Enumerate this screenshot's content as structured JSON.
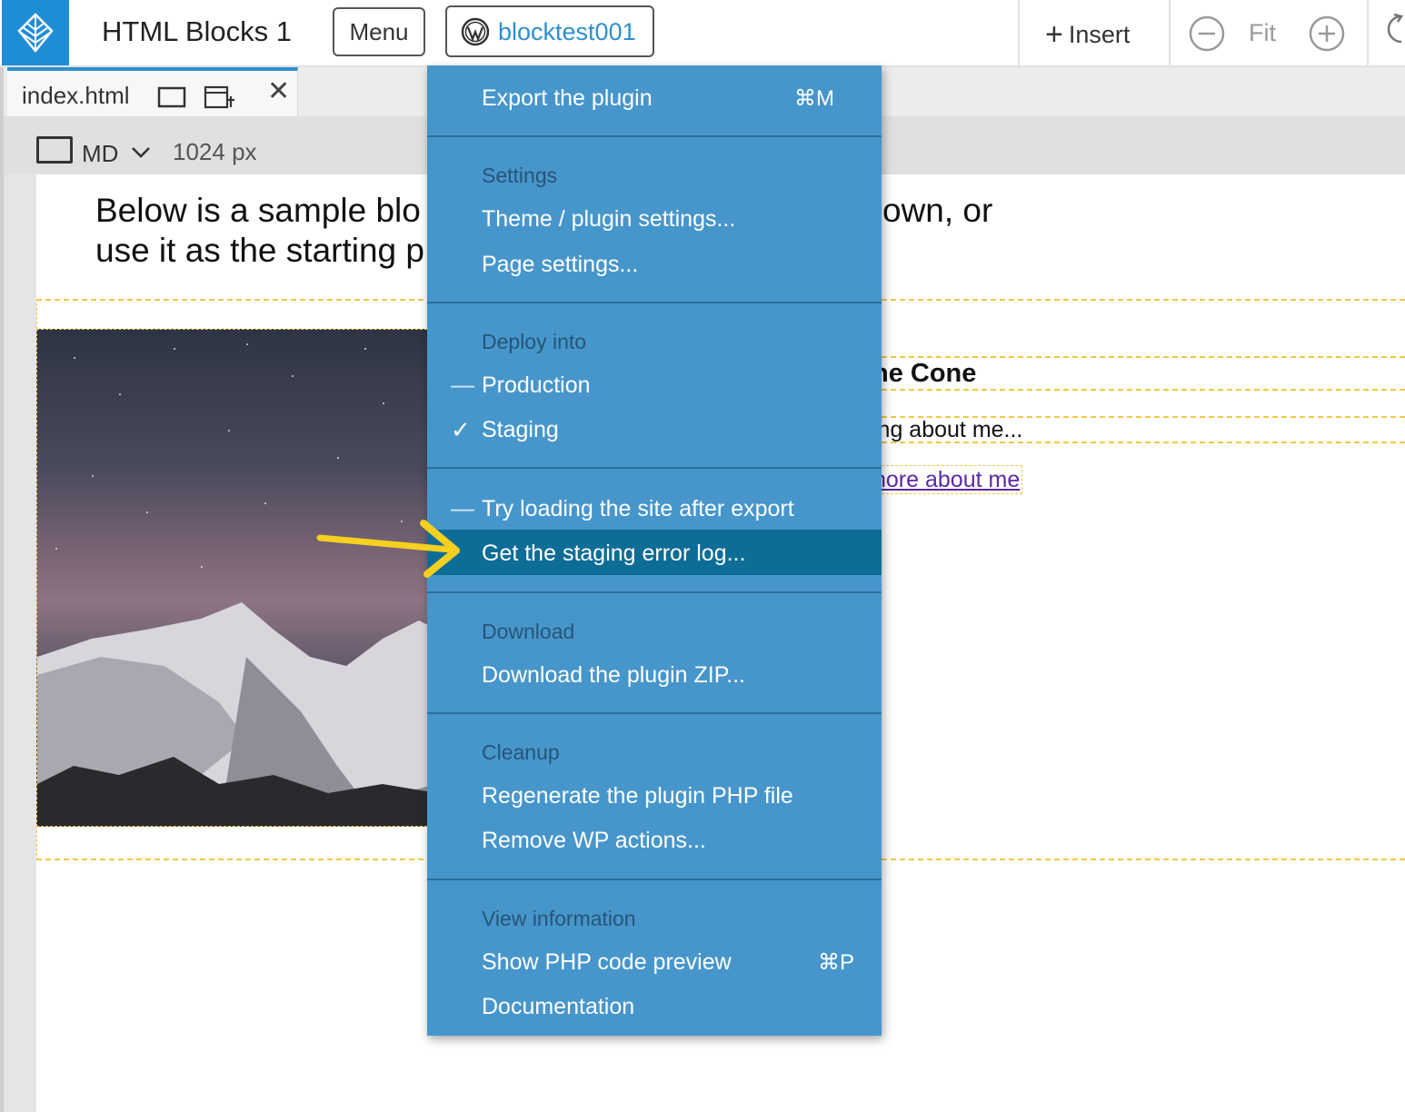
{
  "toolbar": {
    "project_title": "HTML Blocks 1",
    "menu_label": "Menu",
    "site_label": "blocktest001",
    "insert_label": "Insert",
    "fit_label": "Fit"
  },
  "tab": {
    "filename": "index.html"
  },
  "device": {
    "size_label": "MD",
    "width_label": "1024 px"
  },
  "canvas": {
    "intro_line1": "Below is a sample blo",
    "intro_line1_end": "own, or",
    "intro_line2": "use it as the starting p",
    "card_title": "ne Cone",
    "card_text": "ing about me...",
    "card_link": "nore about me"
  },
  "menu": {
    "export": {
      "label": "Export the plugin",
      "shortcut": "⌘M"
    },
    "settings_header": "Settings",
    "theme_settings": "Theme / plugin settings...",
    "page_settings": "Page settings...",
    "deploy_header": "Deploy into",
    "production": "Production",
    "staging": "Staging",
    "try_loading": "Try loading the site after export",
    "error_log": "Get the staging error log...",
    "download_header": "Download",
    "download_zip": "Download the plugin ZIP...",
    "cleanup_header": "Cleanup",
    "regenerate": "Regenerate the plugin PHP file",
    "remove_actions": "Remove WP actions...",
    "info_header": "View information",
    "php_preview": {
      "label": "Show PHP code preview",
      "shortcut": "⌘P"
    },
    "documentation": "Documentation",
    "unchecked_mark": "—",
    "checked_mark": "✓"
  },
  "colors": {
    "accent": "#1f8dd6",
    "menu_bg": "#4796cb",
    "menu_highlight": "#0e6d96",
    "arrow": "#f5d020"
  }
}
